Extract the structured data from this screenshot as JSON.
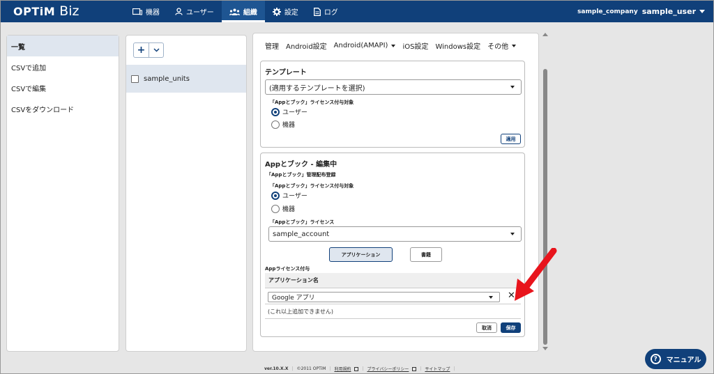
{
  "header": {
    "logo_optim": "OPTiM",
    "logo_biz": "Biz",
    "nav": [
      {
        "label": "機器",
        "icon": "device-icon"
      },
      {
        "label": "ユーザー",
        "icon": "user-icon"
      },
      {
        "label": "組織",
        "icon": "organization-icon",
        "active": true
      },
      {
        "label": "設定",
        "icon": "gear-icon"
      },
      {
        "label": "ログ",
        "icon": "log-icon"
      }
    ],
    "company": "sample_company",
    "user": "sample_user"
  },
  "sidebar": {
    "items": [
      {
        "label": "一覧",
        "active": true
      },
      {
        "label": "CSVで追加"
      },
      {
        "label": "CSVで編集"
      },
      {
        "label": "CSVをダウンロード"
      }
    ]
  },
  "units": {
    "add_button": "+",
    "unit_name": "sample_units"
  },
  "tabs": {
    "items": [
      "管理",
      "Android設定",
      "Android(AMAPI)",
      "iOS設定",
      "Windows設定",
      "その他"
    ]
  },
  "template_card": {
    "title": "テンプレート",
    "select_value": "(適用するテンプレートを選択)",
    "license_label": "「Appとブック」ライセンス付与対象",
    "radio_user": "ユーザー",
    "radio_device": "機器",
    "apply_button": "適用"
  },
  "apps_card": {
    "title": "Appとブック - 編集中",
    "managed_label": "「Appとブック」管理配布登録",
    "license_target_label": "「Appとブック」ライセンス付与対象",
    "radio_user": "ユーザー",
    "radio_device": "機器",
    "license_label": "「Appとブック」ライセンス",
    "license_value": "sample_account",
    "seg_app": "アプリケーション",
    "seg_book": "書籍",
    "app_license_label": "Appライセンス付与",
    "table_header": "アプリケーション名",
    "row_value": "Google アプリ",
    "note": "(これ以上追加できません)",
    "cancel_button": "取消",
    "save_button": "保存"
  },
  "footer": {
    "version": "ver.10.X.X",
    "copyright": "©2011 OPTiM",
    "terms": "利用規約",
    "privacy": "プライバシーポリシー",
    "sitemap": "サイトマップ"
  },
  "manual_button": "マニュアル",
  "colors": {
    "brand": "#10407a",
    "annotation_arrow": "#e8141c"
  }
}
